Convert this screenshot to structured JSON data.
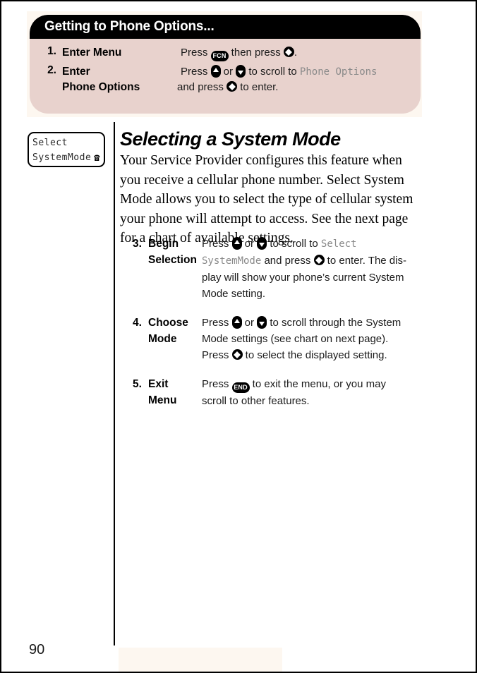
{
  "page": {
    "number": "90",
    "accent_pink": "#E8D2CD",
    "cream": "#FDF7F0",
    "header_black": "#000000"
  },
  "callout": {
    "title": "Getting to Phone Options...",
    "steps": [
      {
        "num": "1.",
        "title": "Enter Menu",
        "desc_parts": [
          {
            "type": "text",
            "value": "Press "
          },
          {
            "type": "key",
            "icon": "fcn-key-icon",
            "label": "FCN"
          },
          {
            "type": "text",
            "value": " then press "
          },
          {
            "type": "key",
            "icon": "select-key-icon",
            "label": ""
          },
          {
            "type": "text",
            "value": "."
          }
        ]
      },
      {
        "num": "2.",
        "title_line1": "Enter",
        "title_line2": "Phone Options",
        "desc_parts": [
          {
            "type": "text",
            "value": "Press "
          },
          {
            "type": "key",
            "icon": "up-arrow-key-icon",
            "label": ""
          },
          {
            "type": "text",
            "value": " or "
          },
          {
            "type": "key",
            "icon": "down-arrow-key-icon",
            "label": ""
          },
          {
            "type": "text",
            "value": " to scroll to "
          },
          {
            "type": "lcd",
            "value": "Phone Options"
          },
          {
            "type": "text",
            "value": " and press "
          },
          {
            "type": "key",
            "icon": "select-key-icon",
            "label": ""
          },
          {
            "type": "text",
            "value": " to enter."
          }
        ]
      }
    ]
  },
  "lcd_display": {
    "line1": "Select",
    "line2": "SystemMode",
    "icon": "telephone-icon",
    "icon_glyph": "☎"
  },
  "heading": "Selecting a System Mode",
  "intro": "Your Service Provider configures this feature when you receive a cellular phone number. Select System Mode allows you to select the type of cellular system your phone will attempt to access. See the next page for a chart of available settings.",
  "steps": [
    {
      "num": "3.",
      "title_line1": "Begin",
      "title_line2": "Selection",
      "desc_plain": "Press ▲ or ▼ to scroll to Select SystemMode and press ◆ to enter. The display will show your phone's current System Mode setting."
    },
    {
      "num": "4.",
      "title_line1": "Choose",
      "title_line2": "Mode",
      "desc_plain": "Press ▲ or ▼ to scroll through the System Mode settings (see chart on next page). Press ◆ to select the displayed setting."
    },
    {
      "num": "5.",
      "title_line1": "Exit",
      "title_line2": "Menu",
      "desc_plain": "Press END to exit the menu, or you may scroll to other features."
    }
  ],
  "text_fragments": {
    "press": "Press ",
    "or": " or ",
    "scroll_to": " to scroll to ",
    "and_press": " and press ",
    "to_enter_display": " to enter. The dis-",
    "play_will_show": "play will show your phone’s current System",
    "mode_setting": "Mode setting.",
    "scroll_through_system": " to scroll through the System",
    "mode_settings_chart": "Mode settings (see chart on next page).",
    "to_select_displayed": " to select the displayed setting.",
    "to_exit_menu": " to exit the menu, or you may",
    "scroll_other_features": "scroll to other features.",
    "then_press": " then press ",
    "period": ".",
    "to_enter": " to enter.",
    "phone_options_lcd": "Phone Options",
    "select_lcd": "Select",
    "systemmode_lcd": "SystemMode"
  },
  "keys": {
    "fcn": "FCN",
    "end": "END"
  }
}
